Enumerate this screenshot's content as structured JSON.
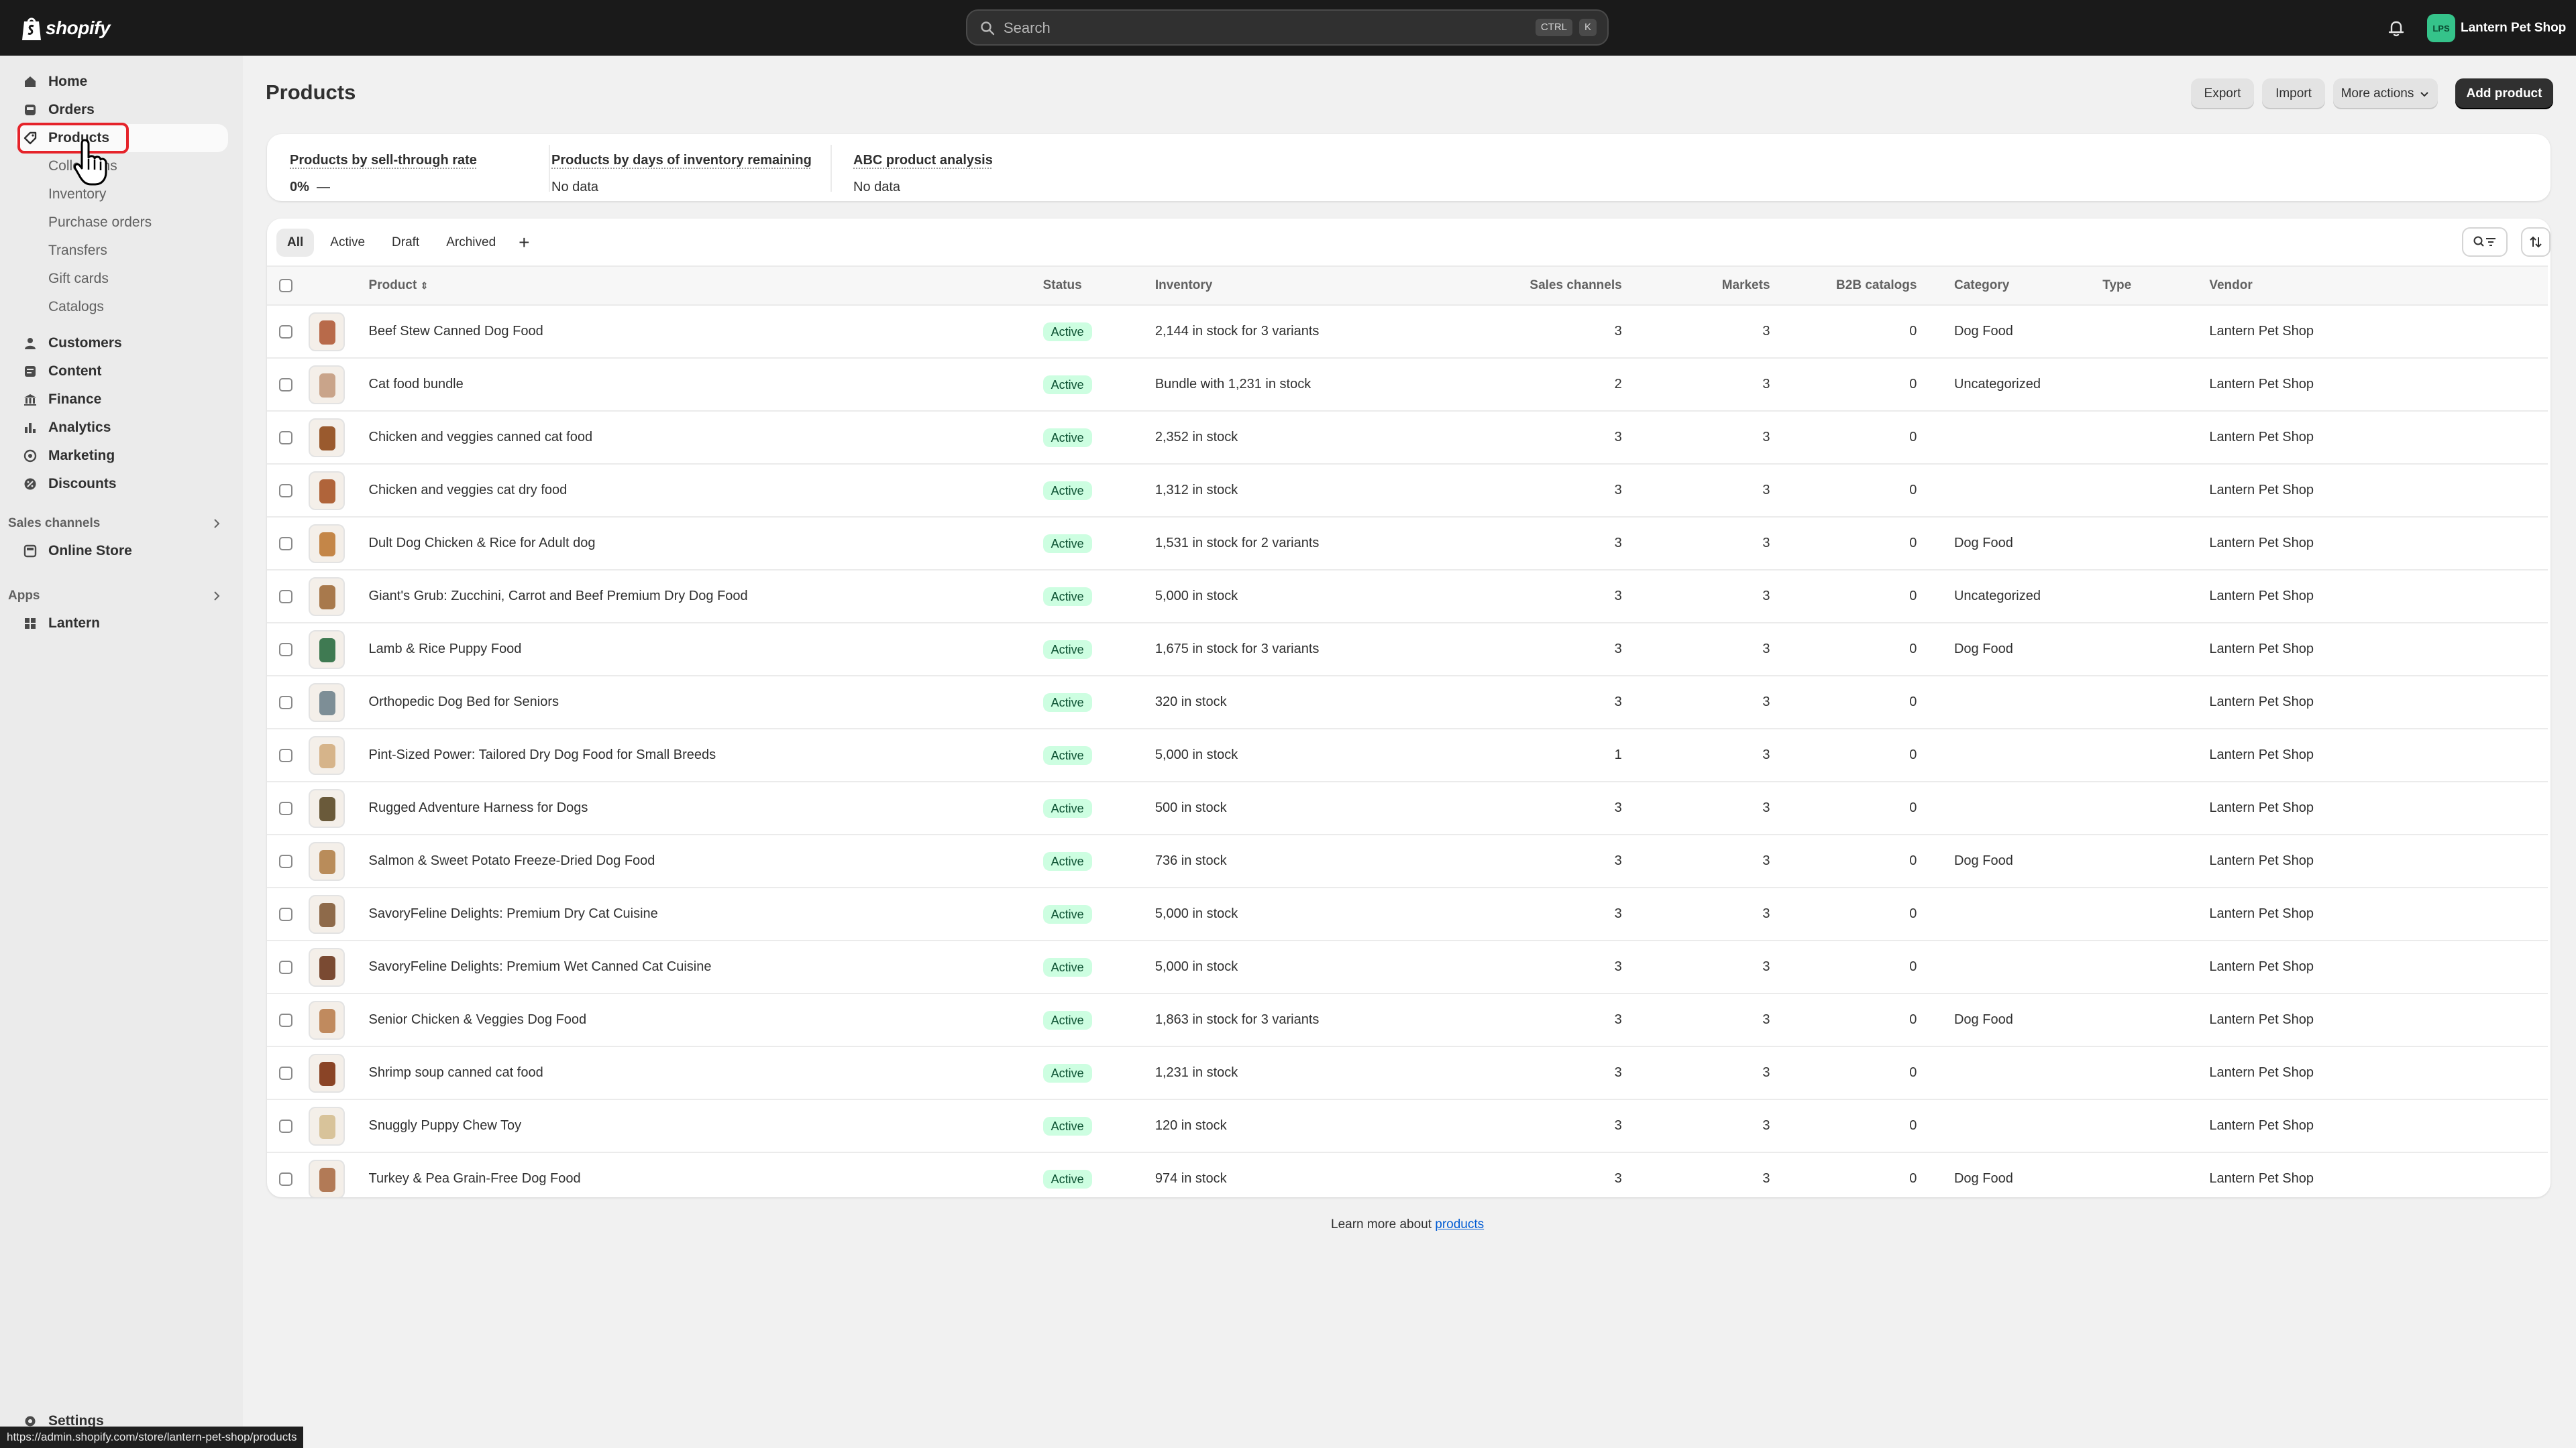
{
  "topbar": {
    "logo_text": "shopify",
    "search_placeholder": "Search",
    "shortcut_ctrl": "CTRL",
    "shortcut_key": "K",
    "store_initials": "LPS",
    "store_name": "Lantern Pet Shop"
  },
  "sidebar": {
    "main_items": [
      {
        "label": "Home",
        "icon": "home-icon"
      },
      {
        "label": "Orders",
        "icon": "inbox-icon"
      },
      {
        "label": "Products",
        "icon": "tag-icon",
        "active": true
      }
    ],
    "product_subitems": [
      "Collections",
      "Inventory",
      "Purchase orders",
      "Transfers",
      "Gift cards",
      "Catalogs"
    ],
    "lower_items": [
      {
        "label": "Customers",
        "icon": "person-icon"
      },
      {
        "label": "Content",
        "icon": "content-icon"
      },
      {
        "label": "Finance",
        "icon": "bank-icon"
      },
      {
        "label": "Analytics",
        "icon": "bar-chart-icon"
      },
      {
        "label": "Marketing",
        "icon": "target-icon"
      },
      {
        "label": "Discounts",
        "icon": "discount-icon"
      }
    ],
    "sales_channels_heading": "Sales channels",
    "sales_channels": [
      {
        "label": "Online Store",
        "icon": "store-icon"
      }
    ],
    "apps_heading": "Apps",
    "apps": [
      {
        "label": "Lantern",
        "icon": "app-grid-icon"
      }
    ],
    "settings_label": "Settings"
  },
  "status_url": "https://admin.shopify.com/store/lantern-pet-shop/products",
  "main": {
    "title": "Products",
    "export_label": "Export",
    "import_label": "Import",
    "more_actions_label": "More actions",
    "add_product_label": "Add product"
  },
  "metrics": [
    {
      "title": "Products by sell-through rate",
      "value_bold": "0%",
      "value_rest": "—"
    },
    {
      "title": "Products by days of inventory remaining",
      "value_bold": "",
      "value_rest": "No data"
    },
    {
      "title": "ABC product analysis",
      "value_bold": "",
      "value_rest": "No data"
    }
  ],
  "tabs": [
    "All",
    "Active",
    "Draft",
    "Archived"
  ],
  "columns": {
    "product": "Product",
    "status": "Status",
    "inventory": "Inventory",
    "sales_channels": "Sales channels",
    "markets": "Markets",
    "b2b": "B2B catalogs",
    "category": "Category",
    "type": "Type",
    "vendor": "Vendor"
  },
  "products": [
    {
      "name": "Beef Stew Canned Dog Food",
      "status": "Active",
      "inventory": "2,144 in stock for 3 variants",
      "channels": "3",
      "markets": "3",
      "b2b": "0",
      "category": "Dog Food",
      "type": "",
      "vendor": "Lantern Pet Shop",
      "thumb": "#b86a4a"
    },
    {
      "name": "Cat food bundle",
      "status": "Active",
      "inventory": "Bundle with 1,231 in stock",
      "channels": "2",
      "markets": "3",
      "b2b": "0",
      "category": "Uncategorized",
      "type": "",
      "vendor": "Lantern Pet Shop",
      "thumb": "#c9a48a"
    },
    {
      "name": "Chicken and veggies canned cat food",
      "status": "Active",
      "inventory": "2,352 in stock",
      "channels": "3",
      "markets": "3",
      "b2b": "0",
      "category": "",
      "type": "",
      "vendor": "Lantern Pet Shop",
      "thumb": "#9a5a2e"
    },
    {
      "name": "Chicken and veggies cat dry food",
      "status": "Active",
      "inventory": "1,312 in stock",
      "channels": "3",
      "markets": "3",
      "b2b": "0",
      "category": "",
      "type": "",
      "vendor": "Lantern Pet Shop",
      "thumb": "#b0643a"
    },
    {
      "name": "Dult Dog Chicken & Rice for Adult dog",
      "status": "Active",
      "inventory": "1,531 in stock for 2 variants",
      "channels": "3",
      "markets": "3",
      "b2b": "0",
      "category": "Dog Food",
      "type": "",
      "vendor": "Lantern Pet Shop",
      "thumb": "#c48648"
    },
    {
      "name": "Giant's Grub: Zucchini, Carrot and Beef Premium Dry Dog Food",
      "status": "Active",
      "inventory": "5,000 in stock",
      "channels": "3",
      "markets": "3",
      "b2b": "0",
      "category": "Uncategorized",
      "type": "",
      "vendor": "Lantern Pet Shop",
      "thumb": "#a8794c"
    },
    {
      "name": "Lamb & Rice Puppy Food",
      "status": "Active",
      "inventory": "1,675 in stock for 3 variants",
      "channels": "3",
      "markets": "3",
      "b2b": "0",
      "category": "Dog Food",
      "type": "",
      "vendor": "Lantern Pet Shop",
      "thumb": "#3f7a52"
    },
    {
      "name": "Orthopedic Dog Bed for Seniors",
      "status": "Active",
      "inventory": "320 in stock",
      "channels": "3",
      "markets": "3",
      "b2b": "0",
      "category": "",
      "type": "",
      "vendor": "Lantern Pet Shop",
      "thumb": "#7d8e96"
    },
    {
      "name": "Pint-Sized Power: Tailored Dry Dog Food for Small Breeds",
      "status": "Active",
      "inventory": "5,000 in stock",
      "channels": "1",
      "markets": "3",
      "b2b": "0",
      "category": "",
      "type": "",
      "vendor": "Lantern Pet Shop",
      "thumb": "#d6b48a"
    },
    {
      "name": "Rugged Adventure Harness for Dogs",
      "status": "Active",
      "inventory": "500 in stock",
      "channels": "3",
      "markets": "3",
      "b2b": "0",
      "category": "",
      "type": "",
      "vendor": "Lantern Pet Shop",
      "thumb": "#6a5a3a"
    },
    {
      "name": "Salmon & Sweet Potato Freeze-Dried Dog Food",
      "status": "Active",
      "inventory": "736 in stock",
      "channels": "3",
      "markets": "3",
      "b2b": "0",
      "category": "Dog Food",
      "type": "",
      "vendor": "Lantern Pet Shop",
      "thumb": "#b98c5a"
    },
    {
      "name": "SavoryFeline Delights: Premium Dry Cat Cuisine",
      "status": "Active",
      "inventory": "5,000 in stock",
      "channels": "3",
      "markets": "3",
      "b2b": "0",
      "category": "",
      "type": "",
      "vendor": "Lantern Pet Shop",
      "thumb": "#8e6a4a"
    },
    {
      "name": "SavoryFeline Delights: Premium Wet Canned Cat Cuisine",
      "status": "Active",
      "inventory": "5,000 in stock",
      "channels": "3",
      "markets": "3",
      "b2b": "0",
      "category": "",
      "type": "",
      "vendor": "Lantern Pet Shop",
      "thumb": "#7a4a32"
    },
    {
      "name": "Senior Chicken & Veggies Dog Food",
      "status": "Active",
      "inventory": "1,863 in stock for 3 variants",
      "channels": "3",
      "markets": "3",
      "b2b": "0",
      "category": "Dog Food",
      "type": "",
      "vendor": "Lantern Pet Shop",
      "thumb": "#c08a5e"
    },
    {
      "name": "Shrimp soup canned cat food",
      "status": "Active",
      "inventory": "1,231 in stock",
      "channels": "3",
      "markets": "3",
      "b2b": "0",
      "category": "",
      "type": "",
      "vendor": "Lantern Pet Shop",
      "thumb": "#8a4426"
    },
    {
      "name": "Snuggly Puppy Chew Toy",
      "status": "Active",
      "inventory": "120 in stock",
      "channels": "3",
      "markets": "3",
      "b2b": "0",
      "category": "",
      "type": "",
      "vendor": "Lantern Pet Shop",
      "thumb": "#d8c39a"
    },
    {
      "name": "Turkey & Pea Grain-Free Dog Food",
      "status": "Active",
      "inventory": "974 in stock",
      "channels": "3",
      "markets": "3",
      "b2b": "0",
      "category": "Dog Food",
      "type": "",
      "vendor": "Lantern Pet Shop",
      "thumb": "#b27a56"
    }
  ],
  "footer": {
    "learn_prefix": "Learn more about",
    "learn_link": "products"
  },
  "colors": {
    "topbar": "#1a1a1a",
    "accent_badge": "#cdfee1",
    "highlight": "#e5232a",
    "link": "#005bd3"
  }
}
